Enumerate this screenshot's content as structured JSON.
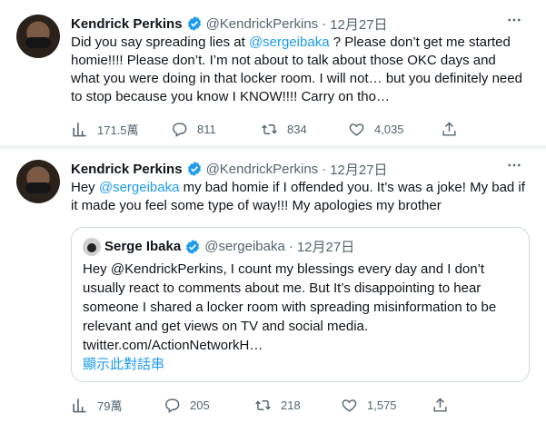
{
  "tweets": [
    {
      "author_name": "Kendrick Perkins",
      "handle": "@KendrickPerkins",
      "separator": "·",
      "date": "12月27日",
      "text_before": "Did you say spreading lies at ",
      "mention": "@sergeibaka",
      "text_after": " ? Please don’t get me started homie!!!! Please don’t. I’m not about to talk about those OKC days and what you were doing in that locker room. I will not… but you definitely need to stop because you know I KNOW!!!! Carry on tho…",
      "stats": {
        "views": "171.5萬",
        "replies": "811",
        "retweets": "834",
        "likes": "4,035"
      }
    },
    {
      "author_name": "Kendrick Perkins",
      "handle": "@KendrickPerkins",
      "separator": "·",
      "date": "12月27日",
      "text_before": "Hey ",
      "mention": "@sergeibaka",
      "text_after": " my bad homie if I offended you. It’s was a joke! My bad if it made you feel some type of way!!! My apologies my brother",
      "quote": {
        "author_name": "Serge Ibaka",
        "handle": "@sergeibaka",
        "separator": "·",
        "date": "12月27日",
        "text": "Hey @KendrickPerkins, I count my blessings every day and I don’t usually react to comments about me. But It’s disappointing to hear someone I shared a locker room with spreading misinformation to be relevant and get views on TV and social media. twitter.com/ActionNetworkH…",
        "show_thread": "顯示此對話串"
      },
      "stats": {
        "views": "79萬",
        "replies": "205",
        "retweets": "218",
        "likes": "1,575"
      }
    }
  ],
  "colors": {
    "accent": "#1d9bf0",
    "secondary_text": "#536471",
    "border": "#cfd9de"
  },
  "icons": [
    "verified-badge-icon",
    "more-icon",
    "views-icon",
    "reply-icon",
    "retweet-icon",
    "like-icon",
    "share-icon"
  ]
}
